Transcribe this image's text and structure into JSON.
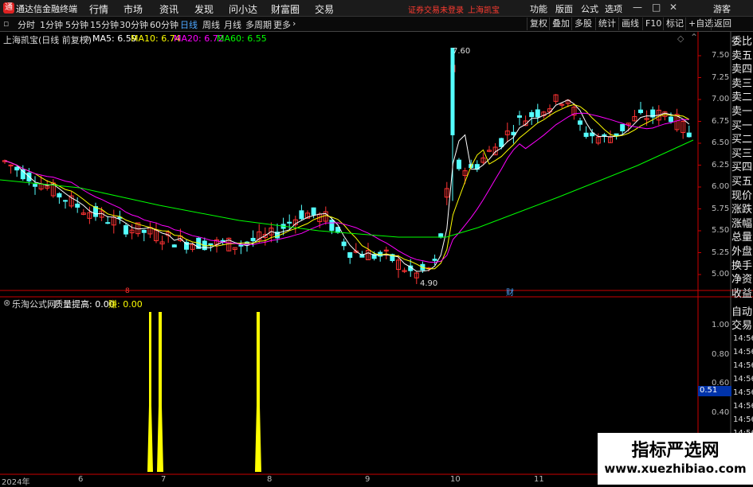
{
  "app": {
    "title": "通达信金融终端",
    "logo": "通"
  },
  "menu": [
    "行情",
    "市场",
    "资讯",
    "发现",
    "问小达",
    "财富圈",
    "交易"
  ],
  "warning": "证券交易未登录",
  "stock_name_top": "上海凯宝",
  "right_menu": [
    "功能",
    "版面",
    "公式",
    "选项"
  ],
  "user": "游客",
  "periods": [
    "分时",
    "1分钟",
    "5分钟",
    "15分钟",
    "30分钟",
    "60分钟",
    "日线",
    "周线",
    "月线",
    "多周期",
    "更多"
  ],
  "active_period": "日线",
  "tools": [
    "复权",
    "叠加",
    "多股",
    "统计",
    "画线",
    "F10",
    "标记",
    "+自选",
    "返回"
  ],
  "header": {
    "stock": "上海凯宝(日线 前复权)",
    "ma5": "MA5: 6.59",
    "ma10": "MA10: 6.74",
    "ma20": "MA20: 6.72",
    "ma60": "MA60: 6.55"
  },
  "indicator": {
    "name": "乐淘公式网",
    "label": "质量提高: 0.00",
    "label2": "赚: 0.00"
  },
  "price_axis": [
    "7.50",
    "7.25",
    "7.00",
    "6.75",
    "6.50",
    "6.25",
    "6.00",
    "5.75",
    "5.50",
    "5.25",
    "5.00"
  ],
  "indicator_axis": [
    "1.00",
    "0.80",
    "0.60",
    "0.40"
  ],
  "indicator_value": "0.51",
  "annotations": {
    "high": "7.60",
    "low": "4.90",
    "marker1": "8",
    "marker2": "财"
  },
  "right_panel": [
    "委比",
    "卖五",
    "卖四",
    "卖三",
    "卖二",
    "卖一",
    "买一",
    "买二",
    "买三",
    "买四",
    "买五",
    "现价",
    "涨跌",
    "涨幅",
    "总量",
    "外盘",
    "换手",
    "净资",
    "收益"
  ],
  "right_panel2": [
    "自动",
    "交易"
  ],
  "times": [
    "14:56",
    "14:56",
    "14:56",
    "14:56",
    "14:56",
    "14:56",
    "14:56",
    "14:56"
  ],
  "x_labels": [
    "2024年",
    "6",
    "7",
    "8",
    "9",
    "10",
    "11"
  ],
  "watermark": {
    "title": "指标严选网",
    "url": "www.xuezhibiao.com"
  },
  "colors": {
    "up": "#ff3333",
    "down": "#54ffff",
    "ma5": "#ffffff",
    "ma10": "#ffff00",
    "ma20": "#ff00ff",
    "ma60": "#00ff00",
    "signal": "#ffff00"
  }
}
